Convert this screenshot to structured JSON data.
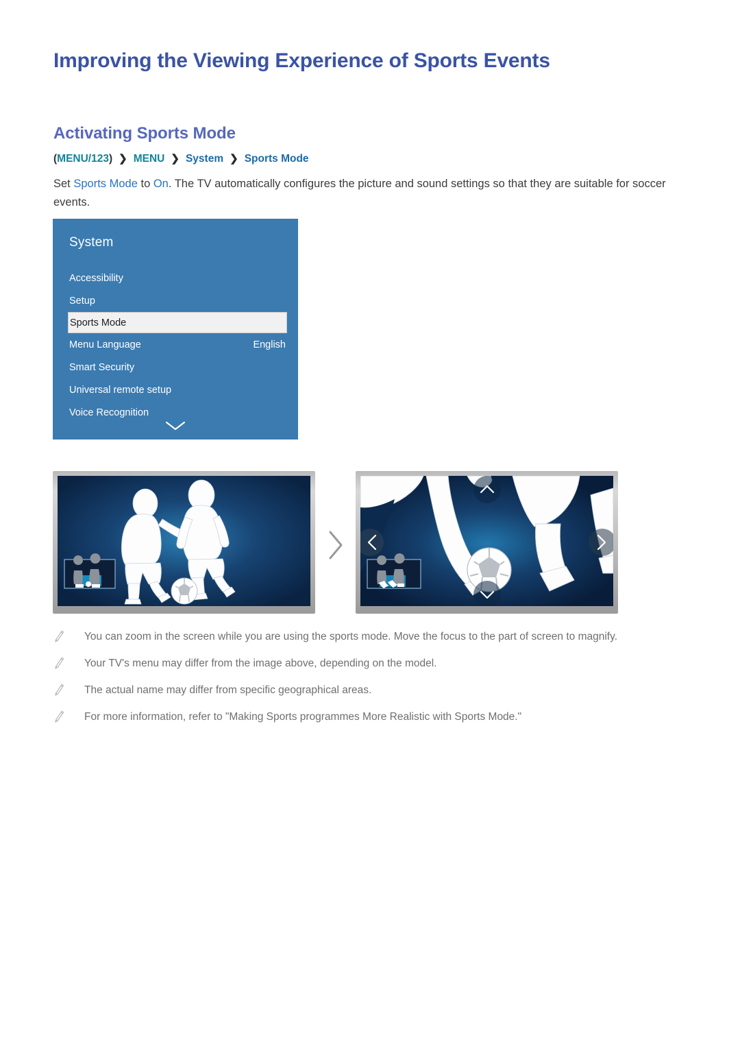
{
  "page": {
    "title": "Improving the Viewing Experience of Sports Events",
    "section_title": "Activating Sports Mode"
  },
  "breadcrumb": {
    "open_paren": "(",
    "close_paren": ")",
    "items": [
      {
        "label": "MENU/123",
        "kind": "key"
      },
      {
        "label": "MENU",
        "kind": "key"
      },
      {
        "label": "System",
        "kind": "node"
      },
      {
        "label": "Sports Mode",
        "kind": "node"
      }
    ],
    "separator": "❯"
  },
  "body": {
    "part1": "Set ",
    "highlight1": "Sports Mode",
    "part2": " to ",
    "highlight2": "On",
    "part3": ". The TV automatically configures the picture and sound settings so that they are suitable for soccer events."
  },
  "tv_menu": {
    "heading": "System",
    "items": [
      {
        "label": "Accessibility",
        "value": "",
        "selected": false
      },
      {
        "label": "Setup",
        "value": "",
        "selected": false
      },
      {
        "label": "Sports Mode",
        "value": "",
        "selected": true
      },
      {
        "label": "Menu Language",
        "value": "English",
        "selected": false
      },
      {
        "label": "Smart Security",
        "value": "",
        "selected": false
      },
      {
        "label": "Universal remote setup",
        "value": "",
        "selected": false
      },
      {
        "label": "Voice Recognition",
        "value": "",
        "selected": false
      }
    ],
    "scroll_icon": "chevron-down-icon",
    "panel_color": "#3b7bb0",
    "selected_row_color": "#f1f1f1"
  },
  "illustrations": {
    "transition_icon": "chevron-right-icon",
    "left": {
      "caption_icon": "soccer-players-illustration",
      "pip_icon": "picture-in-picture-thumbnail"
    },
    "right": {
      "caption_icon": "soccer-zoom-illustration",
      "pip_icon": "picture-in-picture-thumbnail",
      "nav_icons": [
        "chevron-up-icon",
        "chevron-down-icon",
        "chevron-left-icon",
        "chevron-right-icon"
      ]
    }
  },
  "notes": {
    "icon": "pencil-note-icon",
    "items": [
      "You can zoom in the screen while you are using the sports mode. Move the focus to the part of screen to magnify.",
      "Your TV's menu may differ from the image above, depending on the model.",
      "The actual name may differ from specific geographical areas.",
      "For more information, refer to \"Making Sports programmes More Realistic with Sports Mode.\""
    ]
  },
  "colors": {
    "title": "#3a53a4",
    "section_title": "#5668bb",
    "breadcrumb_key": "#12859b",
    "breadcrumb_node": "#1b6ba8",
    "body_highlight": "#2a73c4",
    "note_text": "#6f6f6f"
  }
}
